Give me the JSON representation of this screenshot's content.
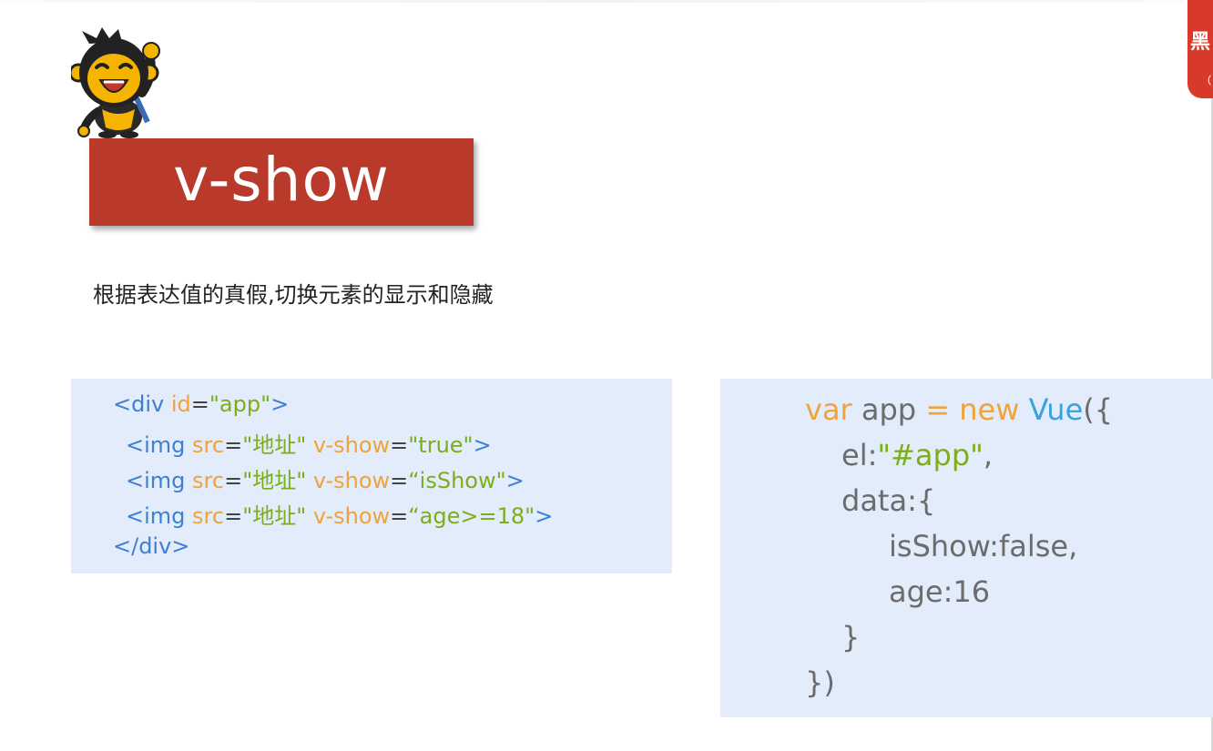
{
  "slide": {
    "title": "v-show",
    "subtitle": "根据表达值的真假,切换元素的显示和隐藏"
  },
  "code_left": {
    "l1_tag1": "<div ",
    "l1_attr": "id",
    "l1_eq": "=",
    "l1_str": "\"app\"",
    "l1_tag2": ">",
    "l2_tag1": "<img ",
    "l2_attr1": "src",
    "l2_eq1": "=",
    "l2_val1": "\"地址\"",
    "l2_attr2": " v-show",
    "l2_eq2": "=",
    "l2_val2": "\"true\"",
    "l2_tag2": ">",
    "l3_tag1": "<img ",
    "l3_attr1": "src",
    "l3_eq1": "=",
    "l3_val1": "\"地址\"",
    "l3_attr2": " v-show",
    "l3_eq2": "=",
    "l3_val2": "“isShow\"",
    "l3_tag2": ">",
    "l4_tag1": "<img ",
    "l4_attr1": "src",
    "l4_eq1": "=",
    "l4_val1": "\"地址\"",
    "l4_attr2": " v-show",
    "l4_eq2": "=",
    "l4_val2": "“age>=18\"",
    "l4_tag2": ">",
    "l5": "</div>"
  },
  "code_right": {
    "r1_kw1": "var",
    "r1_mid": " app ",
    "r1_eq": "=",
    "r1_kw2": " new ",
    "r1_cls": "Vue",
    "r1_end": "({",
    "r2_key": "el:",
    "r2_val": "\"#app\"",
    "r2_end": ",",
    "r3": "data:{",
    "r4": "isShow:false,",
    "r5": "age:16",
    "r6": "}",
    "r7": "})"
  },
  "badge": {
    "label": "黑",
    "sub": "("
  },
  "colors": {
    "title_bg": "#b93a2b",
    "code_bg": "#e2ecfa",
    "tag": "#3d7fd1",
    "attr": "#f0a33a",
    "string": "#7bae1a"
  },
  "icons": {
    "mascot": "monkey-mascot-icon"
  }
}
